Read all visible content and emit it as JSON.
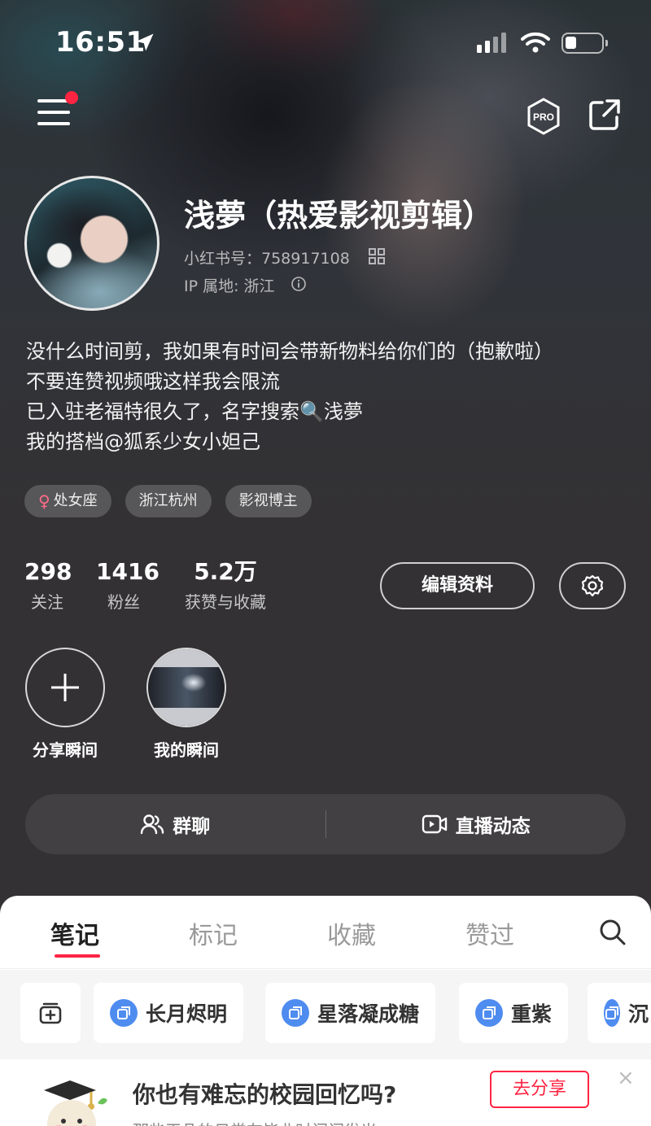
{
  "status_bar": {
    "time": "16:51"
  },
  "profile": {
    "nickname": "浅夢（热爱影视剪辑）",
    "redbook_id": "小红书号：758917108",
    "ip_location": "IP 属地: 浙江",
    "bio_lines": [
      "没什么时间剪，我如果有时间会带新物料给你们的（抱歉啦）",
      "不要连赞视频哦这样我会限流",
      "已入驻老福特很久了，名字搜索🔍浅夢",
      "我的搭档@狐系少女小妲己"
    ],
    "tags": [
      {
        "icon": "female-icon",
        "icon_glyph": "♀",
        "label": "处女座"
      },
      {
        "label": "浙江杭州"
      },
      {
        "label": "影视博主"
      }
    ],
    "stats": [
      {
        "value": "298",
        "label": "关注"
      },
      {
        "value": "1416",
        "label": "粉丝"
      },
      {
        "value": "5.2万",
        "label": "获赞与收藏"
      }
    ],
    "edit_label": "编辑资料"
  },
  "moments": [
    {
      "label": "分享瞬间",
      "icon": "plus-icon"
    },
    {
      "label": "我的瞬间",
      "icon": "moment-thumbnail"
    }
  ],
  "action_bar": {
    "group_chat": "群聊",
    "live": "直播动态"
  },
  "tabs": [
    {
      "label": "笔记",
      "active": true
    },
    {
      "label": "标记",
      "active": false
    },
    {
      "label": "收藏",
      "active": false
    },
    {
      "label": "赞过",
      "active": false
    }
  ],
  "collections": [
    "长月烬明",
    "星落凝成糖",
    "重紫",
    "沉"
  ],
  "promo": {
    "title": "你也有难忘的校园回忆吗?",
    "subtitle": "那些平凡的日常在毕业时闪闪发光",
    "button": "去分享",
    "close": "×"
  },
  "colors": {
    "accent": "#ff2442",
    "background": "#333134",
    "chip_icon": "#4f8cf0"
  }
}
